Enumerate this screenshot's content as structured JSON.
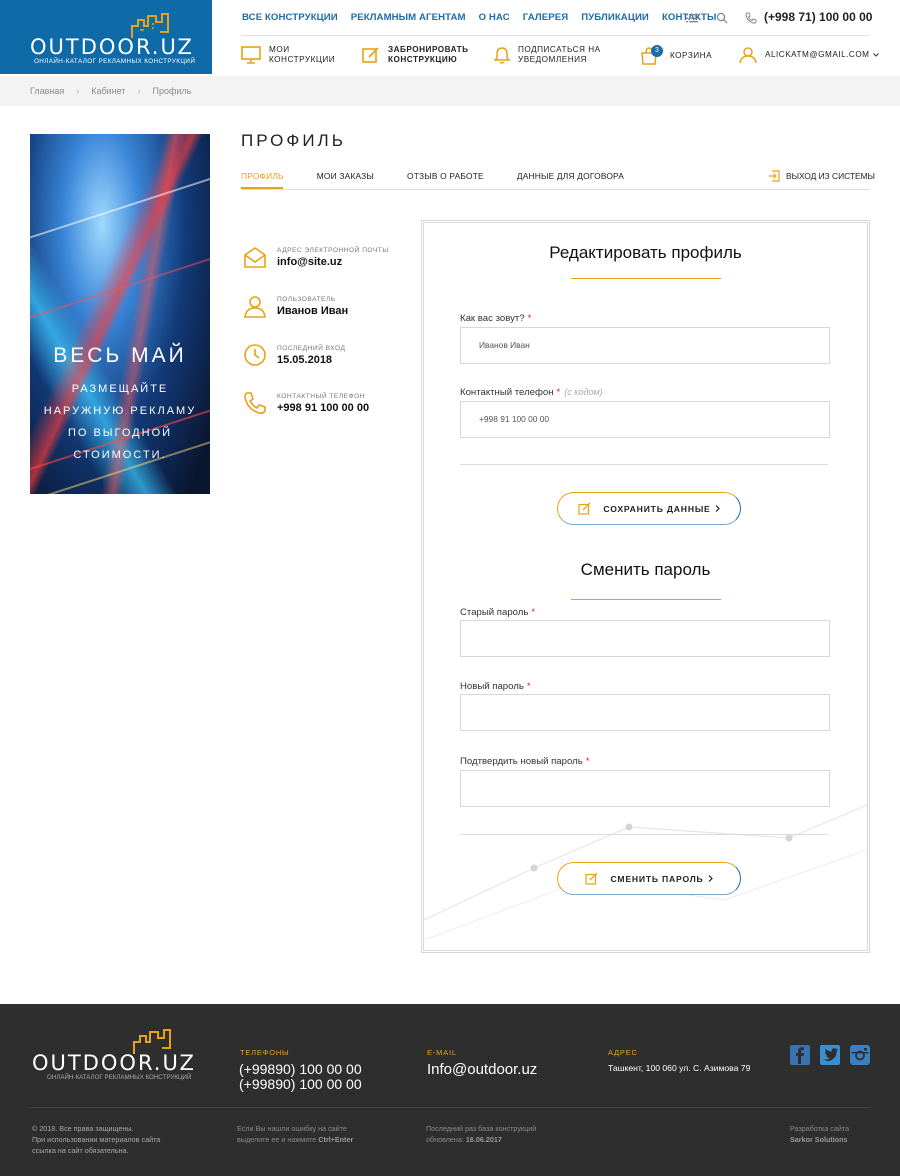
{
  "brand": {
    "name": "OUTDOOR.UZ",
    "tagline": "ОНЛАЙН-КАТАЛОГ РЕКЛАМНЫХ КОНСТРУКЦИЙ"
  },
  "topnav": [
    "ВСЕ КОНСТРУКЦИИ",
    "РЕКЛАМНЫМ АГЕНТАМ",
    "О НАС",
    "ГАЛЕРЕЯ",
    "ПУБЛИКАЦИИ",
    "КОНТАКТЫ"
  ],
  "header_phone": "(+998 71) 100 00 00",
  "subnav": {
    "my_constructions": [
      "МОИ",
      "КОНСТРУКЦИИ"
    ],
    "reserve": [
      "ЗАБРОНИРОВАТЬ",
      "КОНСТРУКЦИЮ"
    ],
    "subscribe": [
      "ПОДПИСАТЬСЯ НА",
      "УВЕДОМЛЕНИЯ"
    ],
    "cart_label": "КОРЗИНА",
    "cart_count": "3",
    "account": "ALICKATM@GMAIL.COM"
  },
  "breadcrumb": [
    "Главная",
    "Кабинет",
    "Профиль"
  ],
  "banner": {
    "title": "ВЕСЬ МАЙ",
    "lines": [
      "РАЗМЕЩАЙТЕ",
      "НАРУЖНУЮ РЕКЛАМУ",
      "ПО ВЫГОДНОЙ",
      "СТОИМОСТИ."
    ]
  },
  "page_title": "ПРОФИЛЬ",
  "tabs": [
    "ПРОФИЛЬ",
    "МОИ ЗАКАЗЫ",
    "ОТЗЫВ О РАБОТЕ",
    "ДАННЫЕ ДЛЯ ДОГОВОРА"
  ],
  "logout": "ВЫХОД ИЗ СИСТЕМЫ",
  "info": {
    "email_cap": "АДРЕС ЭЛЕКТРОННОЙ ПОЧТЫ",
    "email": "info@site.uz",
    "user_cap": "ПОЛЬЗОВАТЕЛЬ",
    "user": "Иванов Иван",
    "login_cap": "ПОСЛЕДНИЙ ВХОД",
    "login": "15.05.2018",
    "phone_cap": "КОНТАКТНЫЙ ТЕЛЕФОН",
    "phone": "+998 91 100 00 00"
  },
  "edit": {
    "title": "Редактировать профиль",
    "name_label": "Как вас зовут?",
    "name_value": "Иванов Иван",
    "phone_label": "Контактный телефон",
    "phone_hint": "(с кодом)",
    "phone_value": "+998 91 100 00 00",
    "save": "СОХРАНИТЬ ДАННЫЕ"
  },
  "password": {
    "title": "Сменить пароль",
    "old": "Старый пароль",
    "new": "Новый пароль",
    "confirm": "Подтвердить новый пароль",
    "submit": "СМЕНИТЬ ПАРОЛЬ"
  },
  "footer": {
    "phones_cap": "ТЕЛЕФОНЫ",
    "phone1": "(+99890) 100 00 00",
    "phone2": "(+99890) 100 00 00",
    "email_cap": "E-MAIL",
    "email": "Info@outdoor.uz",
    "addr_cap": "АДРЕС",
    "addr": "Ташкент, 100 060 ул. С. Азимова 79",
    "copy": [
      "© 2018. Все права защищены.",
      "При использовании материалов сайта",
      "ссылка на сайт обязательна."
    ],
    "error_note": [
      "Если Вы нашли ошибку на сайте",
      "выделите ее и нажмите"
    ],
    "error_key": "Ctrl+Enter",
    "update_note": [
      "Последний раз база конструкций",
      "обновлена:"
    ],
    "update_date": "16.06.2017",
    "dev_note": "Разработка сайта",
    "dev_name": "Sarkor Solutions"
  },
  "colors": {
    "brand_blue": "#0f6aa8",
    "accent": "#e8a217",
    "footer": "#2e2e2e"
  }
}
